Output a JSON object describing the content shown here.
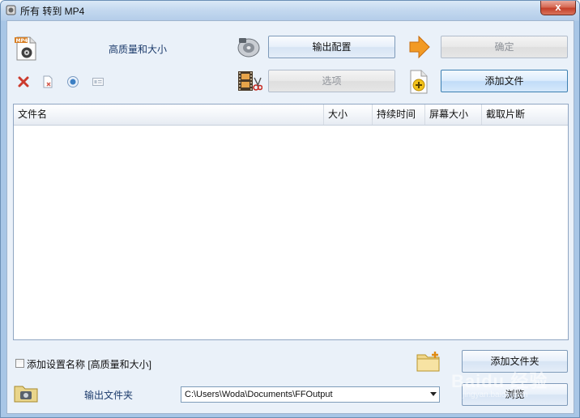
{
  "window": {
    "title": "所有 转到 MP4",
    "close_label": "x"
  },
  "profile": {
    "label": "高质量和大小"
  },
  "buttons": {
    "output_config": "输出配置",
    "ok": "确定",
    "options": "选项",
    "add_file": "添加文件",
    "add_folder": "添加文件夹",
    "browse": "浏览"
  },
  "format_badge": "MP4",
  "file_list": {
    "columns": [
      "文件名",
      "大小",
      "持续时间",
      "屏幕大小",
      "截取片断"
    ],
    "rows": []
  },
  "bottom": {
    "append_setting_label": "添加设置名称 [高质量和大小]",
    "append_setting_checked": false,
    "output_folder_label": "输出文件夹",
    "output_path": "C:\\Users\\Woda\\Documents\\FFOutput"
  },
  "watermark": {
    "line1": "Baidu 经验",
    "line2": "jingyan.baidu.com"
  },
  "colors": {
    "accent_orange": "#f29a24",
    "delete_red": "#cc3b2e",
    "border_blue": "#7e9ab9"
  }
}
